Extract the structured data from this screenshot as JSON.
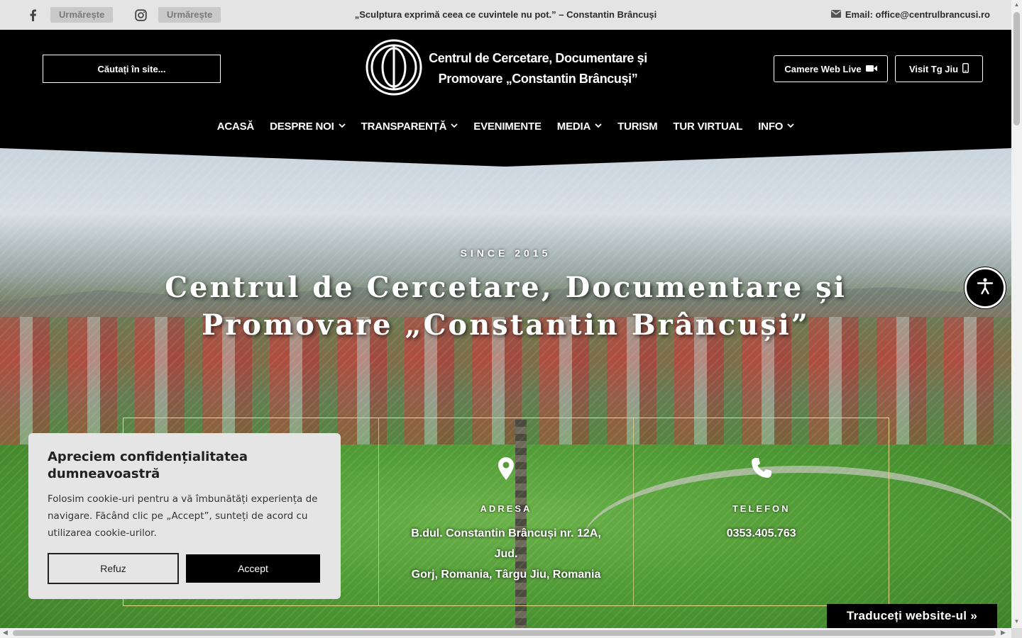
{
  "topbar": {
    "facebook_follow": "Urmărește",
    "instagram_follow": "Urmărește",
    "quote": "„Sculptura exprimă ceea ce cuvintele nu pot.” – Constantin Brâncuși",
    "email": "Email: office@centrulbrancusi.ro"
  },
  "header": {
    "search_label": "Căutați în site...",
    "brand_line1": "Centrul de Cercetare, Documentare și",
    "brand_line2": "Promovare „Constantin Brâncuși”",
    "webcam_label": "Camere Web Live",
    "visit_label": "Visit Tg Jiu"
  },
  "nav": {
    "items": [
      {
        "label": "ACASĂ",
        "dropdown": false
      },
      {
        "label": "DESPRE NOI",
        "dropdown": true
      },
      {
        "label": "TRANSPARENȚĂ",
        "dropdown": true
      },
      {
        "label": "EVENIMENTE",
        "dropdown": false
      },
      {
        "label": "MEDIA",
        "dropdown": true
      },
      {
        "label": "TURISM",
        "dropdown": false
      },
      {
        "label": "TUR VIRTUAL",
        "dropdown": false
      },
      {
        "label": "INFO",
        "dropdown": true
      }
    ]
  },
  "hero": {
    "since": "SINCE 2015",
    "title_line1": "Centrul de Cercetare, Documentare și",
    "title_line2": "Promovare „Constantin Brâncuși”"
  },
  "info": {
    "address_label": "ADRESA",
    "address_line1": "B.dul. Constantin Brâncuși nr. 12A, Jud.",
    "address_line2": "Gorj, Romania, Târgu Jiu, Romania",
    "phone_label": "TELEFON",
    "phone_value": "0353.405.763"
  },
  "cookie": {
    "title": "Apreciem confidențialitatea dumneavoastră",
    "body": "Folosim cookie-uri pentru a vă îmbunătăți experiența de navigare.  Făcând clic pe „Accept”, sunteți de acord cu utilizarea cookie-urilor.",
    "refuse_label": "Refuz",
    "accept_label": "Accept"
  },
  "translate": {
    "label": "Traduceți website-ul »"
  },
  "icons": {
    "facebook": "facebook-icon",
    "instagram": "instagram-icon",
    "email": "envelope-icon",
    "webcam": "video-camera-icon",
    "phone_mobile": "mobile-phone-icon",
    "location": "map-pin-icon",
    "phone": "phone-icon",
    "accessibility": "accessibility-icon"
  },
  "colors": {
    "header_bg": "#000000",
    "topbar_bg": "#e4e4e4",
    "info_border": "#e6d68a",
    "cookie_bg": "#e5e5e5"
  }
}
